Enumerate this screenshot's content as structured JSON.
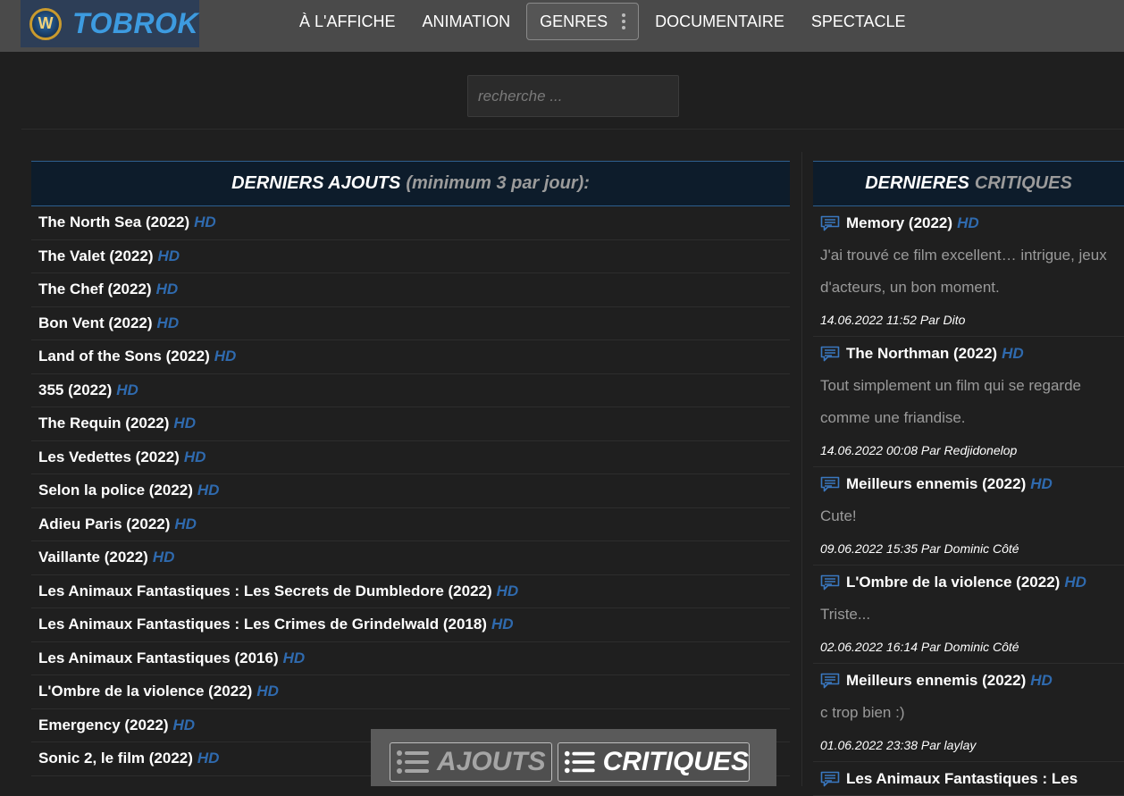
{
  "brand": {
    "name": "TOBROK",
    "badge_letter": "W"
  },
  "nav": [
    {
      "label": "À L'AFFICHE"
    },
    {
      "label": "ANIMATION"
    },
    {
      "label": "GENRES"
    },
    {
      "label": "DOCUMENTAIRE"
    },
    {
      "label": "SPECTACLE"
    }
  ],
  "search": {
    "placeholder": "recherche ..."
  },
  "latest": {
    "title_main": "DERNIERS AJOUTS",
    "title_sub": "(minimum 3 par jour):",
    "items": [
      {
        "title": "The North Sea (2022)",
        "badge": "HD"
      },
      {
        "title": "The Valet (2022)",
        "badge": "HD"
      },
      {
        "title": "The Chef (2022)",
        "badge": "HD"
      },
      {
        "title": "Bon Vent (2022)",
        "badge": "HD"
      },
      {
        "title": "Land of the Sons (2022)",
        "badge": "HD"
      },
      {
        "title": "355 (2022)",
        "badge": "HD"
      },
      {
        "title": "The Requin (2022)",
        "badge": "HD"
      },
      {
        "title": "Les Vedettes (2022)",
        "badge": "HD"
      },
      {
        "title": "Selon la police (2022)",
        "badge": "HD"
      },
      {
        "title": "Adieu Paris (2022)",
        "badge": "HD"
      },
      {
        "title": "Vaillante (2022)",
        "badge": "HD"
      },
      {
        "title": "Les Animaux Fantastiques : Les Secrets de Dumbledore (2022)",
        "badge": "HD"
      },
      {
        "title": "Les Animaux Fantastiques : Les Crimes de Grindelwald (2018)",
        "badge": "HD"
      },
      {
        "title": "Les Animaux Fantastiques (2016)",
        "badge": "HD"
      },
      {
        "title": "L'Ombre de la violence (2022)",
        "badge": "HD"
      },
      {
        "title": "Emergency (2022)",
        "badge": "HD"
      },
      {
        "title": "Sonic 2, le film (2022)",
        "badge": "HD"
      }
    ]
  },
  "reviews": {
    "title_main": "DERNIERES",
    "title_sub": "CRITIQUES",
    "items": [
      {
        "movie": "Memory (2022)",
        "badge": "HD",
        "text": "J'ai trouvé ce film excellent… intrigue, jeux d'acteurs, un bon moment.",
        "meta": "14.06.2022 11:52 Par Dito"
      },
      {
        "movie": "The Northman (2022)",
        "badge": "HD",
        "text": "Tout simplement un film qui se regarde comme une friandise.",
        "meta": "14.06.2022 00:08 Par Redjidonelop"
      },
      {
        "movie": "Meilleurs ennemis (2022)",
        "badge": "HD",
        "text": "Cute!",
        "meta": "09.06.2022 15:35 Par Dominic Côté"
      },
      {
        "movie": "L'Ombre de la violence (2022)",
        "badge": "HD",
        "text": "Triste...",
        "meta": "02.06.2022 16:14 Par Dominic Côté"
      },
      {
        "movie": "Meilleurs ennemis (2022)",
        "badge": "HD",
        "text": "c trop bien :)",
        "meta": "01.06.2022 23:38 Par laylay"
      },
      {
        "movie": "Les Animaux Fantastiques : Les",
        "badge": "",
        "text": "",
        "meta": ""
      }
    ]
  },
  "bottom_bar": {
    "ajouts_label": "AJOUTS",
    "critiques_label": "CRITIQUES"
  },
  "colors": {
    "accent_blue": "#2f6aae",
    "logo_blue": "#3d9be0",
    "header_bg": "#0d1c2b",
    "page_bg": "#1f1f1f"
  }
}
